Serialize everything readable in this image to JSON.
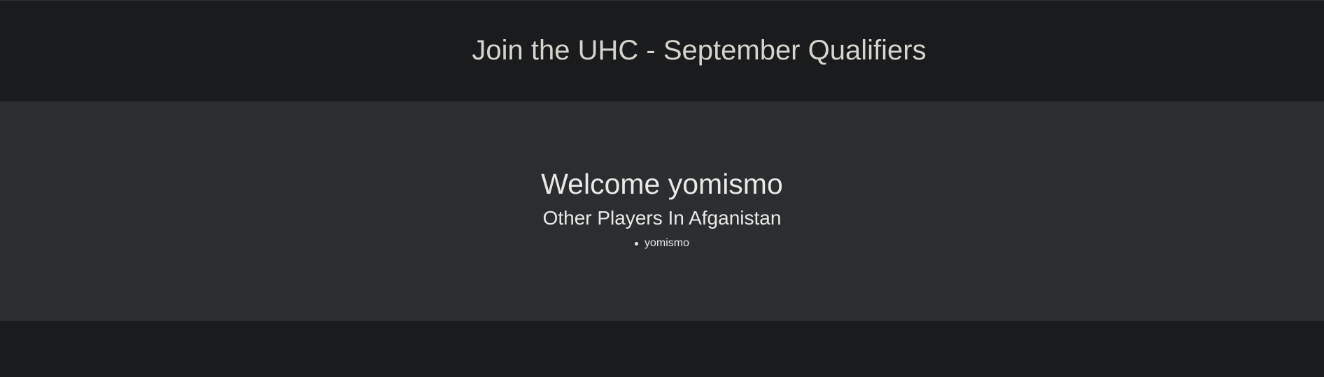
{
  "header": {
    "title": "Join the UHC - September Qualifiers"
  },
  "main": {
    "welcome_text": "Welcome yomismo",
    "subtitle": "Other Players In Afganistan",
    "players": [
      {
        "name": "yomismo"
      }
    ]
  },
  "colors": {
    "header_background": "#1a1b1d",
    "main_background": "#2b2e31",
    "header_text": "#d6d3cd",
    "body_text": "#ebe9e6"
  }
}
